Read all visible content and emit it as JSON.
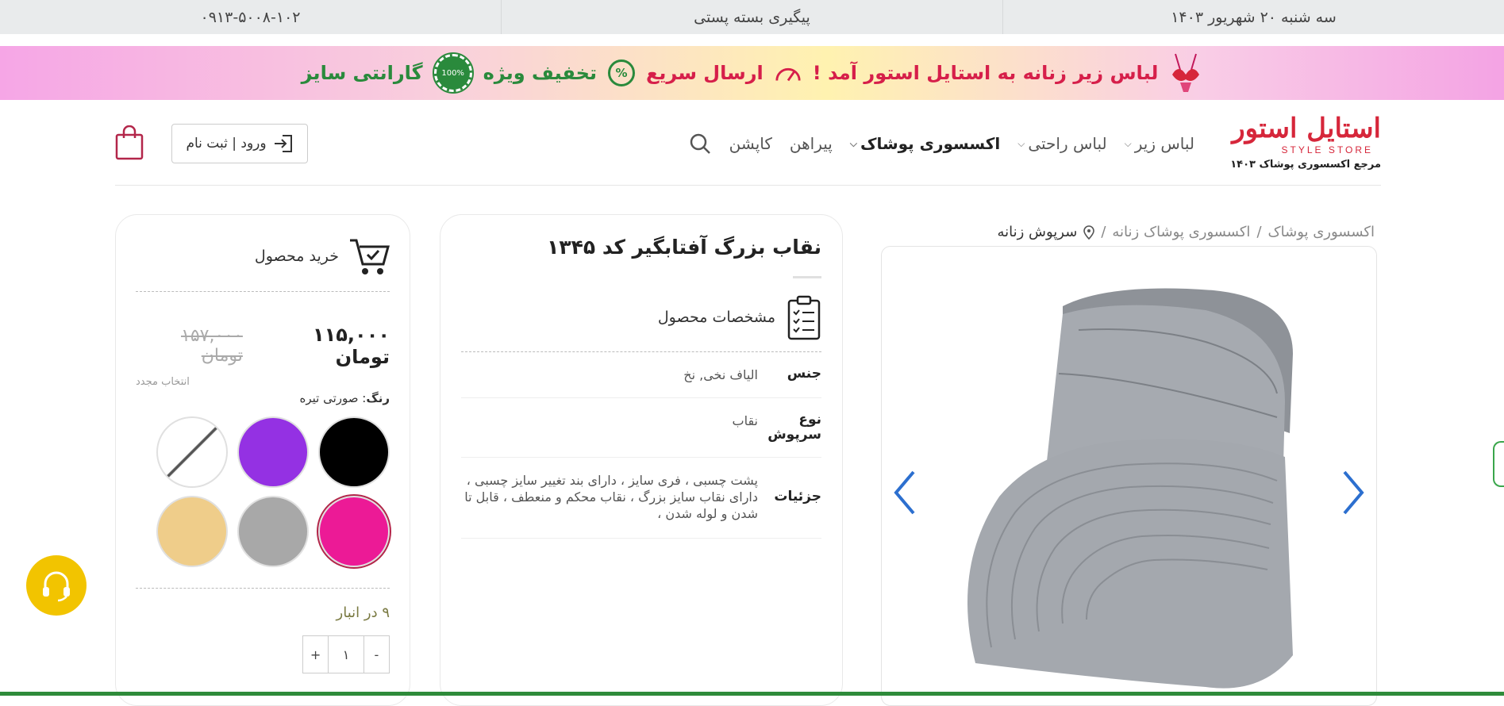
{
  "topbar": {
    "phone": "۰۹۱۳-۵۰۰۸-۱۰۲",
    "tracking": "پیگیری بسته پستی",
    "date": "سه شنبه ۲۰ شهریور ۱۴۰۳"
  },
  "banner": {
    "headline": "لباس زیر زنانه به استایل استور آمد !",
    "fast_shipping": "ارسال سریع",
    "special_discount": "تخفیف ویژه",
    "size_guarantee": "گارانتی سایز",
    "seal_text": "100%"
  },
  "logo": {
    "brand": "استایل استور",
    "english": "STYLE STORE",
    "tagline": "مرجع اکسسوری پوشاک ۱۴۰۳"
  },
  "nav": {
    "items": [
      {
        "label": "لباس زیر",
        "dropdown": true
      },
      {
        "label": "لباس راحتی",
        "dropdown": true
      },
      {
        "label": "اکسسوری پوشاک",
        "dropdown": true
      },
      {
        "label": "پیراهن",
        "dropdown": false
      },
      {
        "label": "کاپشن",
        "dropdown": false
      }
    ],
    "login_label": "ورود | ثبت نام"
  },
  "breadcrumb": {
    "items": [
      "اکسسوری پوشاک",
      "اکسسوری پوشاک زنانه"
    ],
    "current": "سرپوش زنانه",
    "separator": "/"
  },
  "product": {
    "title": "نقاب بزرگ آفتابگیر کد ۱۳۴۵",
    "specs_title": "مشخصات محصول",
    "specs": [
      {
        "key": "جنس",
        "value": "الیاف نخی, نخ"
      },
      {
        "key": "نوع سرپوش",
        "value": "نقاب"
      },
      {
        "key": "جزئیات",
        "value": "پشت چسبی ، فری سایز ، دارای بند تغییر سایز چسبی ، دارای نقاب سایز بزرگ ، نقاب محکم و منعطف ، قابل تا شدن و لوله شدن ،"
      }
    ]
  },
  "buy": {
    "title": "خرید محصول",
    "price_new": "۱۱۵,۰۰۰ تومان",
    "price_old": "۱۵۷,۰۰۰ تومان",
    "reselect": "انتخاب مجدد",
    "color_label": "رنگ",
    "color_value": ": صورتی تیره",
    "stock": "۹ در انبار",
    "qty": "۱",
    "plus": "+",
    "minus": "-",
    "swatches": [
      {
        "name": "black",
        "color": "#000000"
      },
      {
        "name": "purple",
        "color": "#9431e3"
      },
      {
        "name": "white-none",
        "color": "#ffffff"
      },
      {
        "name": "dark-pink",
        "color": "#ec1a96"
      },
      {
        "name": "gray",
        "color": "#a8a8a8"
      },
      {
        "name": "beige",
        "color": "#efcd8a"
      }
    ],
    "selected_swatch": "dark-pink"
  },
  "colors": {
    "accent": "#2e8b3a",
    "brand_red": "#d6263a",
    "support": "#f2c400"
  }
}
